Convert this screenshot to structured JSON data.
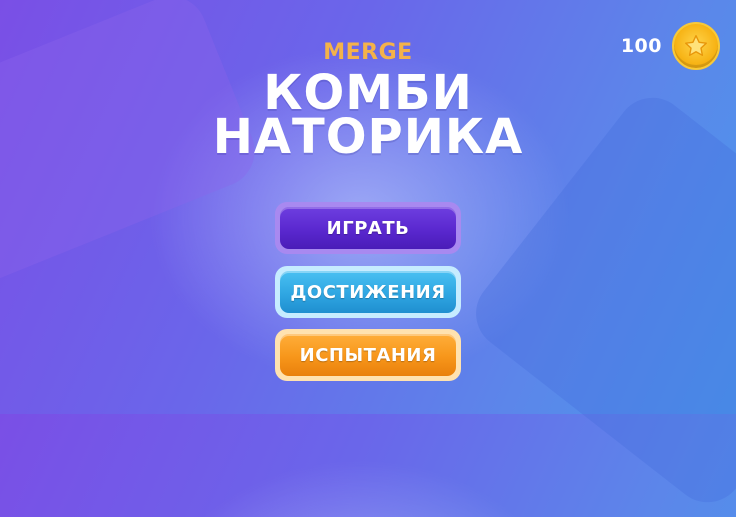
{
  "header": {
    "subtitle": "MERGE",
    "title_line1": "КОМБИ",
    "title_line2": "НАТОРИКА"
  },
  "currency": {
    "count": "100",
    "icon": "star-coin-icon"
  },
  "menu": {
    "play_label": "ИГРАТЬ",
    "achievements_label": "ДОСТИЖЕНИЯ",
    "trials_label": "ИСПЫТАНИЯ"
  },
  "colors": {
    "subtitle": "#f4b24a",
    "play": "#5a28cf",
    "achievements": "#2fa6e2",
    "trials": "#f7961a",
    "coin": "#f7b416"
  }
}
